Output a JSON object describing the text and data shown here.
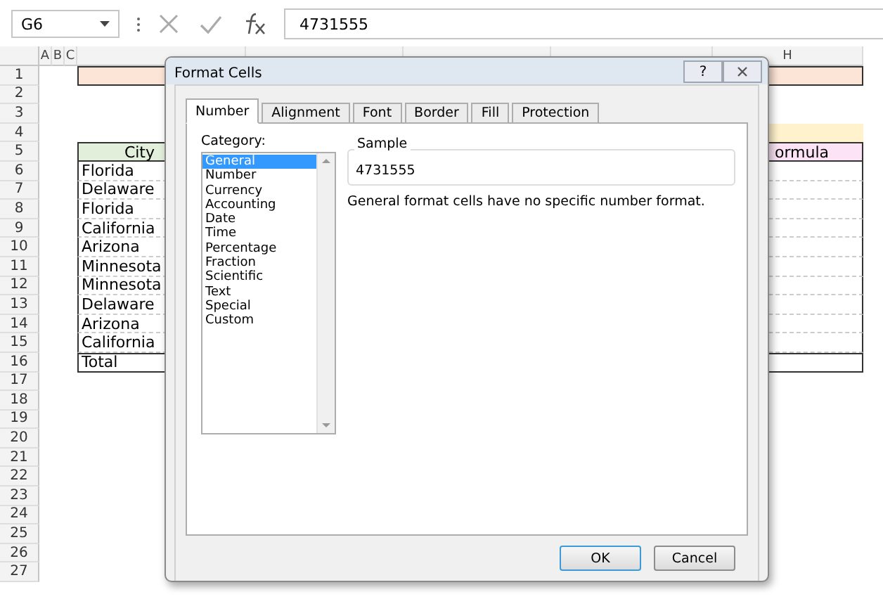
{
  "name_box": "G6",
  "formula": "4731555",
  "columns": [
    "A",
    "B",
    "C",
    "H"
  ],
  "row_numbers": [
    "1",
    "2",
    "3",
    "4",
    "5",
    "6",
    "7",
    "8",
    "9",
    "10",
    "11",
    "12",
    "13",
    "14",
    "15",
    "16",
    "17",
    "18",
    "19",
    "20",
    "21",
    "22",
    "23",
    "24",
    "25",
    "26",
    "27"
  ],
  "table": {
    "header": "City",
    "header_h": "ormula",
    "cities": [
      "Florida",
      "Delaware",
      "Florida",
      "California",
      "Arizona",
      "Minnesota",
      "Minnesota",
      "Delaware",
      "Arizona",
      "California"
    ],
    "total": "Total"
  },
  "dialog": {
    "title": "Format Cells",
    "help": "?",
    "tabs": [
      {
        "label": "Number",
        "selected": true
      },
      {
        "label": "Alignment",
        "selected": false
      },
      {
        "label": "Font",
        "selected": false
      },
      {
        "label": "Border",
        "selected": false
      },
      {
        "label": "Fill",
        "selected": false
      },
      {
        "label": "Protection",
        "selected": false
      }
    ],
    "category_label": "Category:",
    "categories": [
      {
        "label": "General",
        "selected": true
      },
      {
        "label": "Number",
        "selected": false
      },
      {
        "label": "Currency",
        "selected": false
      },
      {
        "label": "Accounting",
        "selected": false
      },
      {
        "label": "Date",
        "selected": false
      },
      {
        "label": "Time",
        "selected": false
      },
      {
        "label": "Percentage",
        "selected": false
      },
      {
        "label": "Fraction",
        "selected": false
      },
      {
        "label": "Scientific",
        "selected": false
      },
      {
        "label": "Text",
        "selected": false
      },
      {
        "label": "Special",
        "selected": false
      },
      {
        "label": "Custom",
        "selected": false
      }
    ],
    "sample_label": "Sample",
    "sample_value": "4731555",
    "description": "General format cells have no specific number format.",
    "buttons": [
      {
        "label": "OK",
        "kind": "default"
      },
      {
        "label": "Cancel",
        "kind": "normal"
      }
    ]
  }
}
